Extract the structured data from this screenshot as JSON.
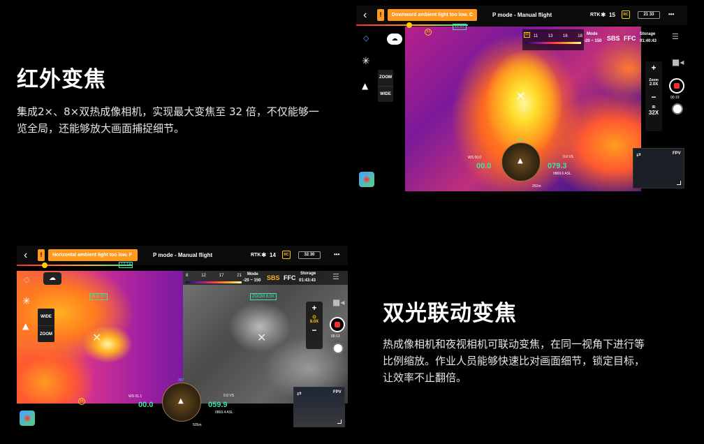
{
  "section1": {
    "title": "红外变焦",
    "desc_line1": "集成2×、8×双热成像相机，实现最大变焦至 32 倍，不仅能够一",
    "desc_line2": "览全局，还能够放大画面捕捉细节。"
  },
  "section2": {
    "title": "双光联动变焦",
    "desc_line1": "热成像相机和夜视相机可联动变焦，在同一视角下进行等",
    "desc_line2": "比例缩放。作业人员能够快速比对画面细节，锁定目标，",
    "desc_line3": "让效率不止翻倍。"
  },
  "screen1": {
    "back": "‹",
    "warn_icon": "!",
    "warning": "Downward ambient light too low. C",
    "mode": "P mode - Manual flight",
    "rtk": "RTK",
    "signal_count": "15",
    "rc": "RC",
    "batt1": "21",
    "batt2": "33",
    "menu": "•••",
    "time_marker": "11:07",
    "palette_ticks": [
      "11",
      "13",
      "16",
      "18"
    ],
    "ir_badge": "IR",
    "mode_label": "Mode",
    "mode_range": "-20 ~ 150",
    "sbs": "SBS",
    "ffc": "FFC",
    "storage_label": "Storage",
    "storage_time": "01:40:43",
    "zoom_btn": "ZOOM",
    "wide_btn": "WIDE",
    "plus": "+",
    "zoom_label": "Zoom",
    "zoom_value": "2.0X",
    "minus": "−",
    "ir_label": "IR",
    "ir_zoom": "32X",
    "rec_time": "00:19",
    "ws": "WS 00.0",
    "hs_value": "00.0",
    "alt_value": "079.3",
    "vs": "0.0  VS",
    "asl": "0869.6 ASL",
    "heading": "236",
    "dist": "252m",
    "fpv": "FPV"
  },
  "screen2": {
    "back": "‹",
    "warn_icon": "!",
    "warning": "Horizontal ambient light too low. F",
    "mode": "P mode - Manual flight",
    "rtk": "RTK",
    "signal_count": "14",
    "rc": "RC",
    "batt1": "32",
    "batt2": "30",
    "menu": "•••",
    "time_marker": "12:14",
    "palette_ticks": [
      "8",
      "12",
      "17",
      "21"
    ],
    "mode_label": "Mode",
    "mode_range": "-20 ~ 150",
    "sbs": "SBS",
    "ffc": "FFC",
    "storage_label": "Storage",
    "storage_time": "01:43:43",
    "ir_zoom_tag": "IR 8.0X",
    "zoom_tag": "ZOOM 8.0X",
    "wide_btn": "WIDE",
    "zoom_btn": "ZOOM",
    "plus": "+",
    "zoom_value": "8.0X",
    "minus": "−",
    "rec_time": "00:13",
    "ws": "WS 01.1",
    "hs_value": "00.0",
    "alt_value": "059.9",
    "vs": "0.0  VS",
    "asl": "0869.4 ASL",
    "heading": "307",
    "dist": "505m",
    "fpv": "FPV"
  },
  "colors": {
    "warning": "#ff9a1f",
    "record": "#ff2a2a",
    "telemetry": "#3fe3a8",
    "thermal_hot": "#ffe030",
    "thermal_cold": "#3a1a8a"
  }
}
